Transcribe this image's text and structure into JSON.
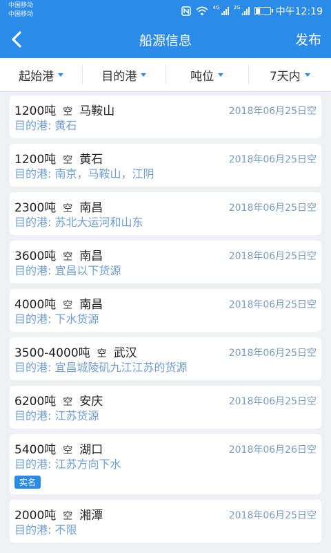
{
  "status_bar": {
    "carrier_1": "中国移动",
    "carrier_2": "中国移动",
    "net_1": "4G",
    "net_2": "2G",
    "time": "中午12:19"
  },
  "header": {
    "title": "船源信息",
    "publish_label": "发布"
  },
  "filters": [
    "起始港",
    "目的港",
    "吨位",
    "7天内"
  ],
  "dest_prefix": "目的港: ",
  "empty_label": "空",
  "listings": [
    {
      "tonnage": "1200吨",
      "origin": "马鞍山",
      "date": "2018年06月25日空",
      "dest": "黄石",
      "badge": ""
    },
    {
      "tonnage": "1200吨",
      "origin": "黄石",
      "date": "2018年06月25日空",
      "dest": "南京，马鞍山，江阴",
      "badge": ""
    },
    {
      "tonnage": "2300吨",
      "origin": "南昌",
      "date": "2018年06月25日空",
      "dest": "苏北大运河和山东",
      "badge": ""
    },
    {
      "tonnage": "3600吨",
      "origin": "南昌",
      "date": "2018年06月25日空",
      "dest": "宜昌以下货源",
      "badge": ""
    },
    {
      "tonnage": "4000吨",
      "origin": "南昌",
      "date": "2018年06月25日空",
      "dest": "下水货源",
      "badge": ""
    },
    {
      "tonnage": "3500-4000吨",
      "origin": "武汉",
      "date": "2018年06月25日空",
      "dest": "宜昌城陵矶九江江苏的货源",
      "badge": ""
    },
    {
      "tonnage": "6200吨",
      "origin": "安庆",
      "date": "2018年06月25日空",
      "dest": "江苏货源",
      "badge": ""
    },
    {
      "tonnage": "5400吨",
      "origin": "湖口",
      "date": "2018年06月26日空",
      "dest": "江苏方向下水",
      "badge": "实名"
    },
    {
      "tonnage": "2000吨",
      "origin": "湘潭",
      "date": "2018年06月25日空",
      "dest": "不限",
      "badge": ""
    }
  ],
  "colors": {
    "primary": "#2b8be8",
    "dest_text": "#6e9fd4",
    "date_text": "#7a9cc3",
    "background": "#eef0f3"
  }
}
